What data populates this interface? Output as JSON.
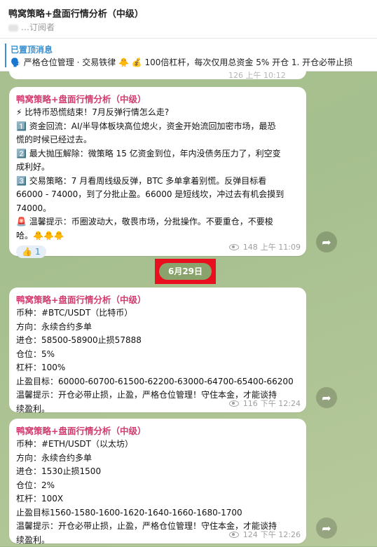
{
  "header": {
    "title": "鸭窝策略+盘面行情分析（中级）",
    "subtitle": "…订阅者"
  },
  "pinned": {
    "title": "已置顶消息",
    "text": "🗣️ 严格仓位管理 · 交易铁律 🐥 💰 100倍杠杆，每次仅用总资金 5% 开仓 1. 开仓必带止损"
  },
  "partial_meta": "126 上午 10:12",
  "messages": [
    {
      "sender": "鸭窝策略+盘面行情分析（中级）",
      "lines": [
        "⚡ 比特币恐慌结束！7月反弹行情怎么走?",
        "1️⃣ 资金回流：AI/半导体板块高位熄火，资金开始流回加密市场，最恐",
        "慌的时候已经过去。",
        "2️⃣ 最大抛压解除：微策略 15 亿资金到位，年内没债务压力了，利空变",
        "成利好。",
        "3️⃣ 交易策略：7 月看周线级反弹，BTC 多单拿着别慌。反弹目标看",
        "66000 - 74000，到了分批止盈。66000 是短线坎，冲过去有机会摸到",
        "74000。",
        "🚨 温馨提示：币圈波动大，敬畏市场，分批操作。不要重仓，不要梭",
        "哈。🐥🐥🐥"
      ],
      "reaction": {
        "emoji": "👍",
        "count": "1"
      },
      "views": "148",
      "time": "上午 11:09"
    },
    {
      "sender": "鸭窝策略+盘面行情分析（中级）",
      "lines": [
        "币种：#BTC/USDT（比特币）",
        "方向：永续合约多单",
        "进仓：58500-58900止损57888",
        "仓位：5%",
        "杠杆：100%",
        "止盈目标：60000-60700-61500-62200-63000-64700-65400-66200",
        "温馨提示：开仓必带止损，止盈，严格仓位管理！守住本金，才能谈持",
        "续盈利。"
      ],
      "views": "116",
      "time": "下午 12:24"
    },
    {
      "sender": "鸭窝策略+盘面行情分析（中级）",
      "lines": [
        "币种：#ETH/USDT（以太坊）",
        "方向：永续合约多单",
        "进仓：1530止损1500",
        "仓位：2%",
        "杠杆：100X",
        "止盈目标1560-1580-1600-1620-1640-1660-1680-1700",
        "温馨提示：开仓必带止损，止盈，严格仓位管理！守住本金，才能谈持",
        "续盈利。"
      ],
      "views": "124",
      "time": "下午 12:26"
    }
  ],
  "date_separator": "6月29日",
  "colors": {
    "sender": "#d23b6d",
    "accent": "#3a8fd1",
    "highlight_box": "#e8101e",
    "chat_bg": "#a9c190"
  },
  "icons": [
    "eye-icon",
    "share-icon",
    "megaphone-icon"
  ]
}
